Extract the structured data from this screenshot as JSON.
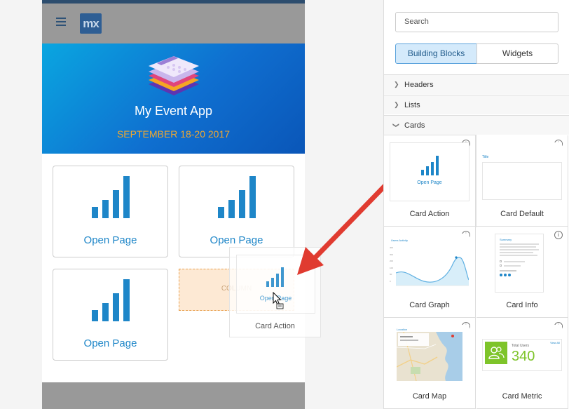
{
  "nav": {
    "logo_text": "mx"
  },
  "hero": {
    "title": "My Event App",
    "subtitle": "SEPTEMBER 18-20 2017"
  },
  "tiles": [
    {
      "label": "Open Page"
    },
    {
      "label": "Open Page"
    },
    {
      "label": "Open Page"
    }
  ],
  "dropzone": {
    "label": "COLUMN"
  },
  "drag_ghost": {
    "inner_text": "Open Page",
    "label": "Card Action"
  },
  "panel": {
    "search_placeholder": "Search",
    "tabs": {
      "building_blocks": "Building Blocks",
      "widgets": "Widgets",
      "active": "Building Blocks"
    },
    "sections": [
      {
        "label": "Headers",
        "expanded": false
      },
      {
        "label": "Lists",
        "expanded": false
      },
      {
        "label": "Cards",
        "expanded": true
      }
    ],
    "cards": [
      {
        "label": "Card Action"
      },
      {
        "label": "Card Default"
      },
      {
        "label": "Card Graph"
      },
      {
        "label": "Card Info"
      },
      {
        "label": "Card Map"
      },
      {
        "label": "Card Metric"
      }
    ],
    "thumbs": {
      "action_text": "Open Page",
      "default_title": "Title",
      "graph_title": "Users Activity",
      "graph_yticks": [
        "400",
        "300",
        "200",
        "100",
        "50",
        "0"
      ],
      "info_title": "Summary",
      "map_title": "Location",
      "metric_label": "Total Users",
      "metric_value": "340",
      "metric_link": "View All"
    }
  },
  "colors": {
    "accent": "#1e86c8",
    "hero_start": "#0aa6e0",
    "hero_end": "#0a56b8",
    "subtitle": "#f0a830",
    "metric_green": "#7ec42a",
    "arrow": "#e03b30"
  }
}
